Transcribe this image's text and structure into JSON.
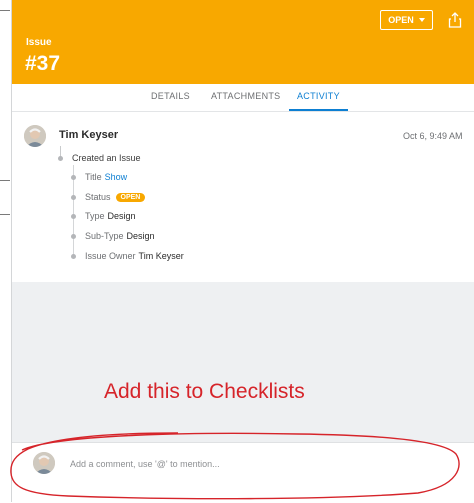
{
  "header": {
    "issue_label": "Issue",
    "issue_number": "#37",
    "status_button_label": "OPEN",
    "background_color": "#f8a800"
  },
  "tabs": [
    {
      "label": "DETAILS",
      "active": false
    },
    {
      "label": "ATTACHMENTS",
      "active": false
    },
    {
      "label": "ACTIVITY",
      "active": true
    }
  ],
  "activity": {
    "author": "Tim Keyser",
    "timestamp": "Oct 6, 9:49 AM",
    "action": "Created an Issue",
    "fields": {
      "title": {
        "label": "Title",
        "value": "Show"
      },
      "status": {
        "label": "Status",
        "value": "OPEN"
      },
      "type": {
        "label": "Type",
        "value": "Design"
      },
      "subtype": {
        "label": "Sub-Type",
        "value": "Design"
      },
      "owner": {
        "label": "Issue Owner",
        "value": "Tim Keyser"
      }
    }
  },
  "annotation": {
    "text": "Add this to Checklists",
    "color": "#d6242a"
  },
  "comment": {
    "placeholder": "Add a comment, use '@' to mention...",
    "value": ""
  },
  "colors": {
    "accent": "#0d7fd2",
    "status_open": "#f8a800",
    "annotation_red": "#d6242a"
  },
  "icons": [
    "share-icon",
    "chevron-down-icon"
  ]
}
